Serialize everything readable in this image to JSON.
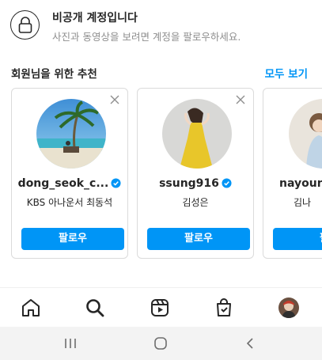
{
  "private_notice": {
    "title": "비공개 계정입니다",
    "subtitle": "사진과 동영상을 보려면 계정을 팔로우하세요.",
    "icon": "lock-icon"
  },
  "suggestions": {
    "title": "회원님을 위한 추천",
    "see_all": "모두 보기",
    "cards": [
      {
        "username": "dong_seok_c...",
        "verified": true,
        "full_name": "KBS 아나운서 최동석",
        "follow_label": "팔로우"
      },
      {
        "username": "ssung916",
        "verified": true,
        "full_name": "김성은",
        "follow_label": "팔로우"
      },
      {
        "username": "nayoung",
        "verified": false,
        "full_name": "김나",
        "follow_label": "팔"
      }
    ]
  },
  "tab_bar": {
    "icons": [
      "home-icon",
      "search-icon",
      "reels-icon",
      "shop-icon",
      "profile-avatar"
    ]
  },
  "system_nav": {
    "icons": [
      "recent-apps-icon",
      "home-circle-icon",
      "back-icon"
    ]
  },
  "colors": {
    "accent": "#0095f6",
    "text": "#262626",
    "secondary_text": "#8e8e8e",
    "border": "#dbdbdb"
  }
}
